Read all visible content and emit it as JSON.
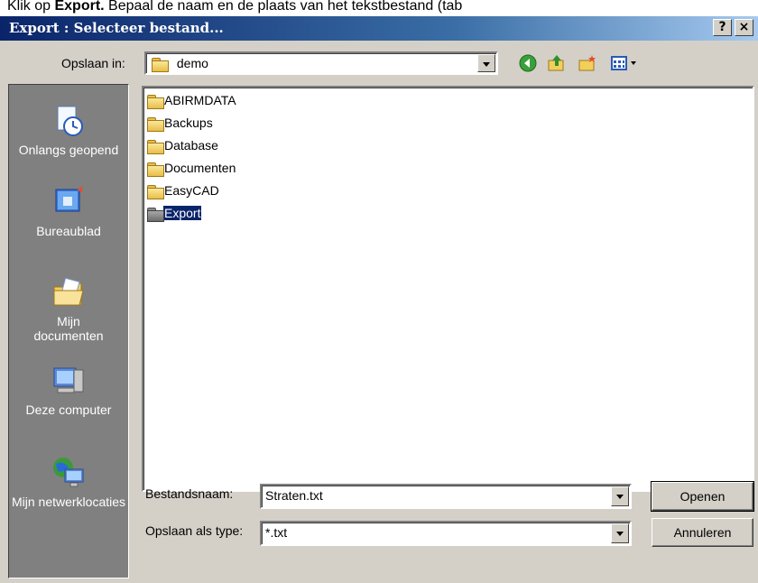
{
  "instruction": {
    "prefix": "Klik op ",
    "bold": "Export.",
    "suffix": " Bepaal de naam en de plaats van het tekstbestand (tab"
  },
  "dialog": {
    "title": "Export : Selecteer bestand...",
    "help_button": "?",
    "close_button": "×"
  },
  "lookin": {
    "label": "Opslaan in:",
    "value": "demo"
  },
  "toolbar": {
    "icons": [
      "back-icon",
      "up-folder-icon",
      "new-folder-icon",
      "view-menu-icon"
    ]
  },
  "places": [
    {
      "label": "Onlangs geopend",
      "icon": "recent-documents-icon"
    },
    {
      "label": "Bureaublad",
      "icon": "desktop-icon"
    },
    {
      "label": "Mijn documenten",
      "icon": "my-documents-icon"
    },
    {
      "label": "Deze computer",
      "icon": "my-computer-icon"
    },
    {
      "label": "Mijn netwerklocaties",
      "icon": "network-places-icon"
    }
  ],
  "files": [
    {
      "name": "ABIRMDATA",
      "selected": false
    },
    {
      "name": "Backups",
      "selected": false
    },
    {
      "name": "Database",
      "selected": false
    },
    {
      "name": "Documenten",
      "selected": false
    },
    {
      "name": "EasyCAD",
      "selected": false
    },
    {
      "name": "Export",
      "selected": true
    }
  ],
  "filename": {
    "label": "Bestandsnaam:",
    "value": "Straten.txt"
  },
  "filetype": {
    "label": "Opslaan als type:",
    "value": "*.txt"
  },
  "buttons": {
    "open": "Openen",
    "cancel": "Annuleren"
  },
  "colors": {
    "title_start": "#0a246a",
    "title_end": "#a6caf0",
    "dialog_bg": "#d4d0c8",
    "places_bg": "#808080",
    "selection": "#0a246a"
  }
}
